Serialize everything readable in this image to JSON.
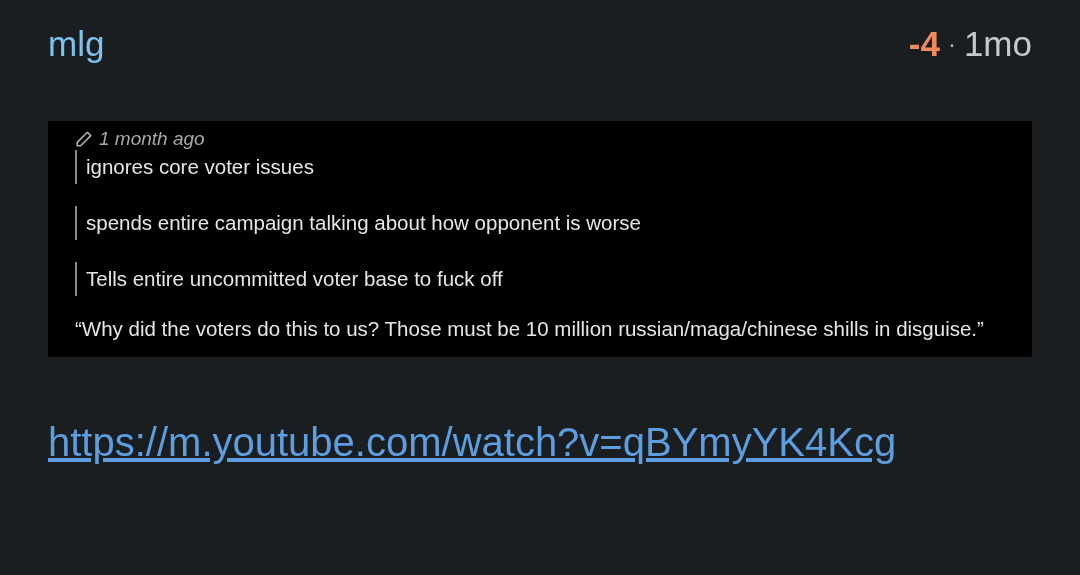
{
  "author": {
    "name": "mlg"
  },
  "score": "-4",
  "separator": "·",
  "age": "1mo",
  "content": {
    "edited": "1 month ago",
    "blocks": [
      {
        "kind": "quote",
        "text": "ignores core voter issues"
      },
      {
        "kind": "quote",
        "text": "spends entire campaign talking about how opponent is worse"
      },
      {
        "kind": "quote",
        "text": "Tells entire uncommitted voter base to fuck off"
      },
      {
        "kind": "paragraph",
        "text": "“Why did the voters do this to us? Those must be 10 million russian/maga/chinese shills in disguise.”"
      }
    ]
  },
  "link": {
    "text": "https://m.youtube.com/watch?v=qBYmyYK4Kcg"
  }
}
